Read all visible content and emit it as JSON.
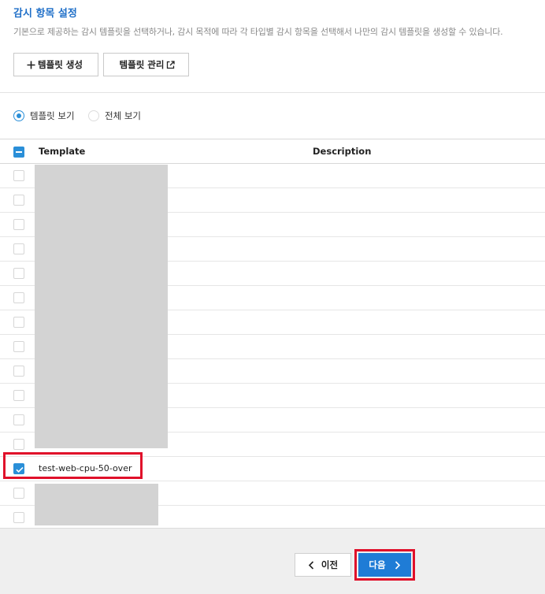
{
  "header": {
    "title": "감시 항목 설정",
    "subtitle": "기본으로 제공하는 감시 템플릿을 선택하거나, 감시 목적에 따라 각 타입별 감시 항목을 선택해서 나만의 감시 템플릿을 생성할 수 있습니다."
  },
  "toolbar": {
    "create_label": "템플릿 생성",
    "manage_label": "템플릿 관리"
  },
  "view_options": {
    "template_view": "템플릿 보기",
    "all_view": "전체 보기",
    "selected": "템플릿 보기"
  },
  "table": {
    "columns": [
      "Template",
      "Description"
    ],
    "rows": [
      {
        "template": "",
        "description": "",
        "checked": false
      },
      {
        "template": "",
        "description": "",
        "checked": false
      },
      {
        "template": "",
        "description": "",
        "checked": false
      },
      {
        "template": "",
        "description": "",
        "checked": false
      },
      {
        "template": "",
        "description": "",
        "checked": false
      },
      {
        "template": "",
        "description": "",
        "checked": false
      },
      {
        "template": "",
        "description": "",
        "checked": false
      },
      {
        "template": "",
        "description": "",
        "checked": false
      },
      {
        "template": "",
        "description": "",
        "checked": false
      },
      {
        "template": "",
        "description": "",
        "checked": false
      },
      {
        "template": "",
        "description": "",
        "checked": false
      },
      {
        "template": "",
        "description": "",
        "checked": false
      },
      {
        "template": "test-web-cpu-50-over",
        "description": "",
        "checked": true
      },
      {
        "template": "",
        "description": "",
        "checked": false
      },
      {
        "template": "",
        "description": "",
        "checked": false
      }
    ]
  },
  "footer": {
    "prev_label": "이전",
    "next_label": "다음"
  },
  "colors": {
    "accent": "#1f7cd6",
    "highlight": "#e0102a"
  }
}
